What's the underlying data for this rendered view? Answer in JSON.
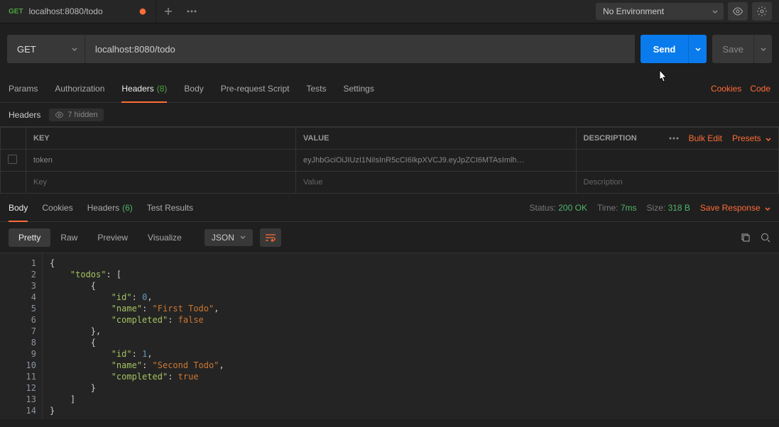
{
  "topbar": {
    "tab_method": "GET",
    "tab_title": "localhost:8080/todo",
    "env_label": "No Environment"
  },
  "request": {
    "method": "GET",
    "url": "localhost:8080/todo",
    "send_label": "Send",
    "save_label": "Save"
  },
  "req_tabs": {
    "params": "Params",
    "auth": "Authorization",
    "headers": "Headers",
    "headers_count": "(8)",
    "body": "Body",
    "prs": "Pre-request Script",
    "tests": "Tests",
    "settings": "Settings",
    "cookies_link": "Cookies",
    "code_link": "Code"
  },
  "headers_sub": {
    "label": "Headers",
    "hidden_text": "7 hidden",
    "th_key": "KEY",
    "th_value": "VALUE",
    "th_desc": "DESCRIPTION",
    "bulk_edit": "Bulk Edit",
    "presets": "Presets",
    "row_key": "token",
    "row_value": "eyJhbGciOiJIUzI1NiIsInR5cCI6IkpXVCJ9.eyJpZCI6MTAsImlh…",
    "ph_key": "Key",
    "ph_value": "Value",
    "ph_desc": "Description"
  },
  "resp_tabs": {
    "body": "Body",
    "cookies": "Cookies",
    "headers": "Headers",
    "headers_count": "(6)",
    "tests": "Test Results",
    "status_lbl": "Status:",
    "status_val": "200 OK",
    "time_lbl": "Time:",
    "time_val": "7ms",
    "size_lbl": "Size:",
    "size_val": "318 B",
    "save_response": "Save Response"
  },
  "view": {
    "pretty": "Pretty",
    "raw": "Raw",
    "preview": "Preview",
    "visualize": "Visualize",
    "format": "JSON"
  },
  "code": {
    "lines": [
      "1",
      "2",
      "3",
      "4",
      "5",
      "6",
      "7",
      "8",
      "9",
      "10",
      "11",
      "12",
      "13",
      "14"
    ],
    "json": {
      "todos": [
        {
          "id": 0,
          "name": "First Todo",
          "completed": false
        },
        {
          "id": 1,
          "name": "Second Todo",
          "completed": true
        }
      ]
    }
  }
}
